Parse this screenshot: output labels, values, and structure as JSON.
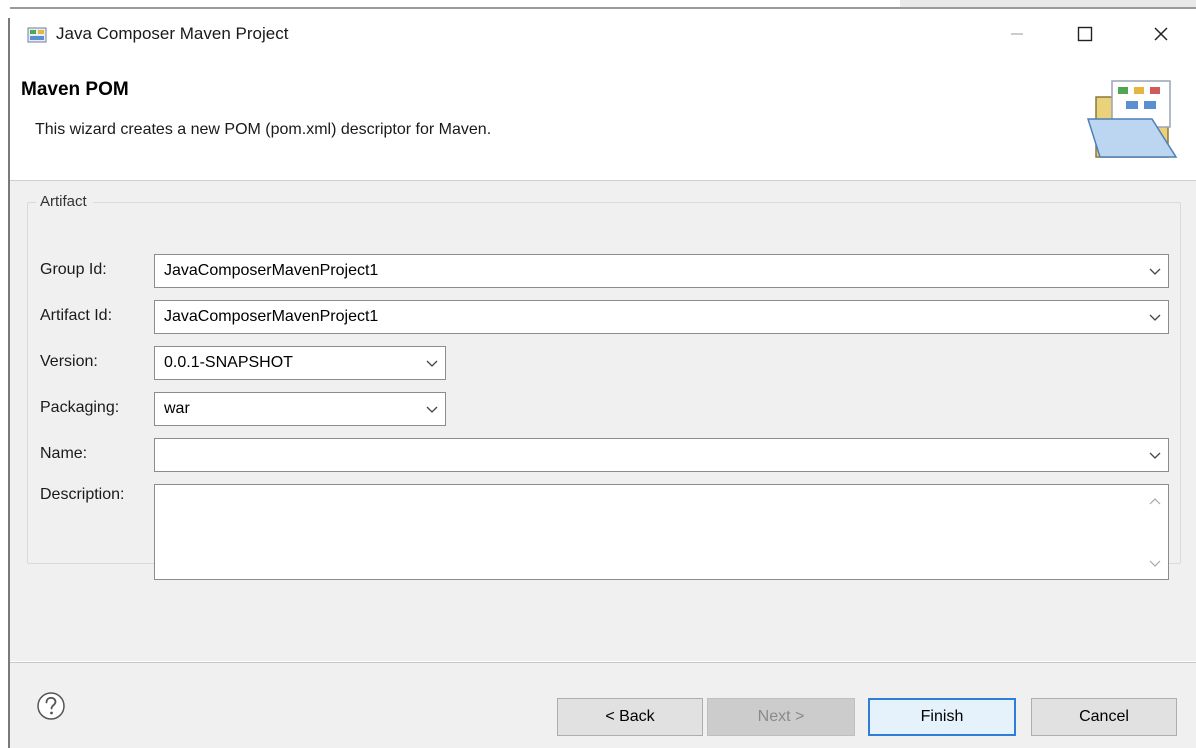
{
  "window": {
    "title": "Java Composer Maven Project",
    "controls": {
      "minimize": "—",
      "maximize": "☐",
      "close": "✕"
    }
  },
  "banner": {
    "title": "Maven POM",
    "description": "This wizard creates a new POM (pom.xml) descriptor for Maven.",
    "icon": "pom-folder-icon"
  },
  "artifact": {
    "group_label": "Artifact",
    "group_id": {
      "label": "Group Id:",
      "value": "JavaComposerMavenProject1"
    },
    "artifact_id": {
      "label": "Artifact Id:",
      "value": "JavaComposerMavenProject1"
    },
    "version": {
      "label": "Version:",
      "value": "0.0.1-SNAPSHOT"
    },
    "packaging": {
      "label": "Packaging:",
      "value": "war"
    },
    "name": {
      "label": "Name:",
      "value": ""
    },
    "description": {
      "label": "Description:",
      "value": ""
    }
  },
  "footer": {
    "help_icon": "help-icon",
    "back_label": "< Back",
    "next_label": "Next >",
    "finish_label": "Finish",
    "cancel_label": "Cancel"
  },
  "colors": {
    "accent": "#2e7dd6",
    "panel_bg": "#f0f0f0",
    "button_bg": "#e1e1e1"
  }
}
